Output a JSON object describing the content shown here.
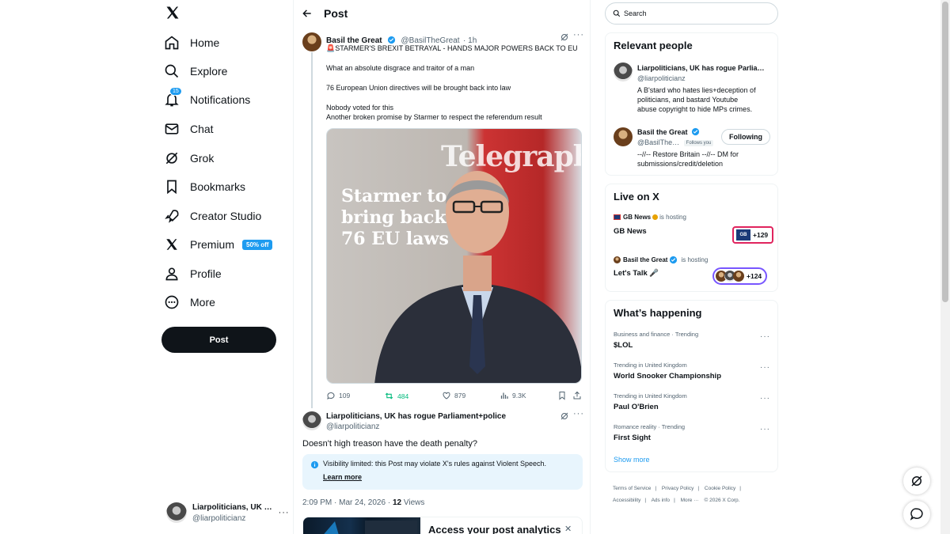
{
  "colors": {
    "accent": "#1d9bf0",
    "text": "#0f1419",
    "muted": "#536471",
    "repost_green": "#00ba7c"
  },
  "nav": {
    "items": [
      {
        "label": "Home",
        "icon": "home-icon"
      },
      {
        "label": "Explore",
        "icon": "search-icon"
      },
      {
        "label": "Notifications",
        "icon": "bell-icon",
        "badge": "15"
      },
      {
        "label": "Chat",
        "icon": "mail-icon"
      },
      {
        "label": "Grok",
        "icon": "grok-icon"
      },
      {
        "label": "Bookmarks",
        "icon": "bookmark-icon"
      },
      {
        "label": "Creator Studio",
        "icon": "rocket-icon"
      },
      {
        "label": "Premium",
        "icon": "x-logo-icon",
        "pill": "50% off"
      },
      {
        "label": "Profile",
        "icon": "person-icon"
      },
      {
        "label": "More",
        "icon": "more-circle-icon"
      }
    ],
    "post_button": "Post",
    "account": {
      "name": "Liarpoliticians, UK …",
      "handle": "@liarpoliticianz"
    }
  },
  "header": {
    "title": "Post"
  },
  "main_post": {
    "author": "Basil the Great",
    "handle": "@BasilTheGreat",
    "time": "· 1h",
    "lines": [
      "🚨STARMER'S BREXIT BETRAYAL - HANDS MAJOR POWERS BACK TO EU",
      "What an absolute disgrace and traitor of a man",
      "76 European Union directives will be brought back into law",
      "Nobody voted for this",
      "Another broken promise by Starmer to respect the referendum result"
    ],
    "image": {
      "masthead": "Telegraph",
      "headline": [
        "Starmer to",
        "bring back",
        "76 EU laws"
      ]
    },
    "stats": {
      "replies": "109",
      "reposts": "484",
      "likes": "879",
      "views": "9.3K"
    }
  },
  "reply": {
    "author": "Liarpoliticians, UK has rogue Parliament+police",
    "handle": "@liarpoliticianz",
    "text": "Doesn't high treason have the death penalty?",
    "notice": "Visibility limited: this Post may violate X's rules against Violent Speech.",
    "learn_more": "Learn more",
    "timestamp": "2:09 PM · Mar 24, 2026 ·",
    "views_count": "12",
    "views_label": "Views"
  },
  "analytics": {
    "title": "Access your post analytics"
  },
  "search": {
    "placeholder": "Search"
  },
  "relevant_people": {
    "title": "Relevant people",
    "people": [
      {
        "name": "Liarpoliticians, UK has rogue Parlia…",
        "handle": "@liarpoliticianz",
        "bio": [
          "A B'stard who hates lies+deception of",
          "politicians, and bastard Youtube",
          "abuse copyright to hide MPs crimes."
        ]
      },
      {
        "name": "Basil the Great",
        "handle": "@BasilThe…",
        "follows_you": "Follows you",
        "button": "Following",
        "bio": [
          "--//-- Restore Britain --//-- DM for",
          "submissions/credit/deletion"
        ]
      }
    ]
  },
  "live": {
    "title": "Live on X",
    "items": [
      {
        "host": "GB News",
        "hosting": "is hosting",
        "title": "GB News",
        "count": "+129"
      },
      {
        "host": "Basil the Great",
        "hosting": "is hosting",
        "title": "Let's Talk 🎤",
        "count": "+124"
      }
    ]
  },
  "happening": {
    "title": "What’s happening",
    "trends": [
      {
        "meta": "Business and finance · Trending",
        "name": "$LOL"
      },
      {
        "meta": "Trending in United Kingdom",
        "name": "World Snooker Championship"
      },
      {
        "meta": "Trending in United Kingdom",
        "name": "Paul O'Brien"
      },
      {
        "meta": "Romance reality · Trending",
        "name": "First Sight"
      }
    ],
    "show_more": "Show more"
  },
  "footer": {
    "links": [
      "Terms of Service",
      "|",
      "Privacy Policy",
      "|",
      "Cookie Policy",
      "|",
      "Accessibility",
      "|",
      "Ads info",
      "|",
      "More ···",
      "© 2026 X Corp."
    ]
  }
}
